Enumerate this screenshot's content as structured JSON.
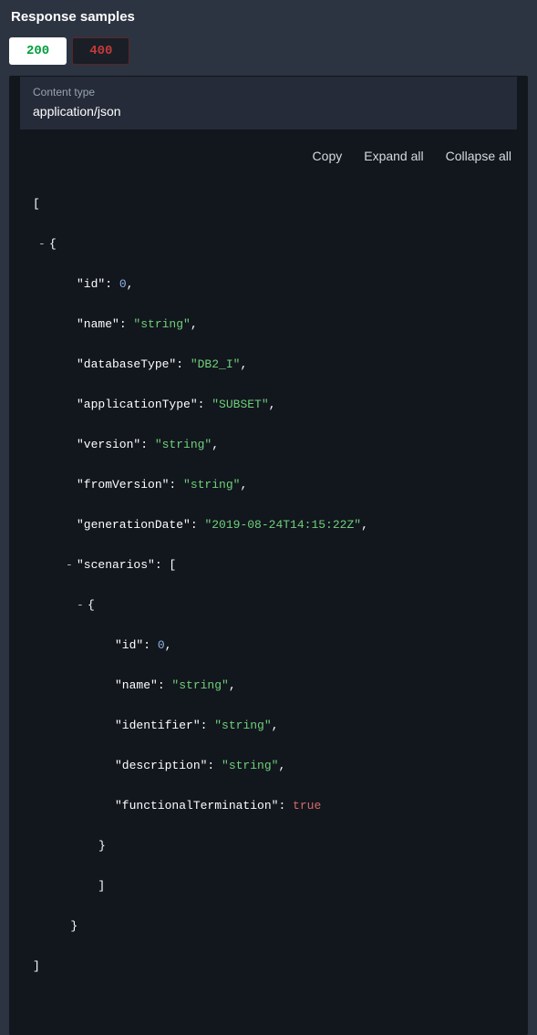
{
  "title": "Response samples",
  "tabs": {
    "t200": "200",
    "t400": "400"
  },
  "contentType": {
    "label": "Content type",
    "value": "application/json"
  },
  "actions": {
    "copy": "Copy",
    "expand": "Expand all",
    "collapse": "Collapse all"
  },
  "json": {
    "id_key": "\"id\"",
    "id_val": "0",
    "name_key": "\"name\"",
    "name_val": "\"string\"",
    "dbtype_key": "\"databaseType\"",
    "dbtype_val": "\"DB2_I\"",
    "apptype_key": "\"applicationType\"",
    "apptype_val": "\"SUBSET\"",
    "version_key": "\"version\"",
    "version_val": "\"string\"",
    "fromver_key": "\"fromVersion\"",
    "fromver_val": "\"string\"",
    "gendate_key": "\"generationDate\"",
    "gendate_val": "\"2019-08-24T14:15:22Z\"",
    "scenarios_key": "\"scenarios\"",
    "sc_id_key": "\"id\"",
    "sc_id_val": "0",
    "sc_name_key": "\"name\"",
    "sc_name_val": "\"string\"",
    "sc_ident_key": "\"identifier\"",
    "sc_ident_val": "\"string\"",
    "sc_desc_key": "\"description\"",
    "sc_desc_val": "\"string\"",
    "sc_func_key": "\"functionalTermination\"",
    "sc_func_val": "true"
  }
}
